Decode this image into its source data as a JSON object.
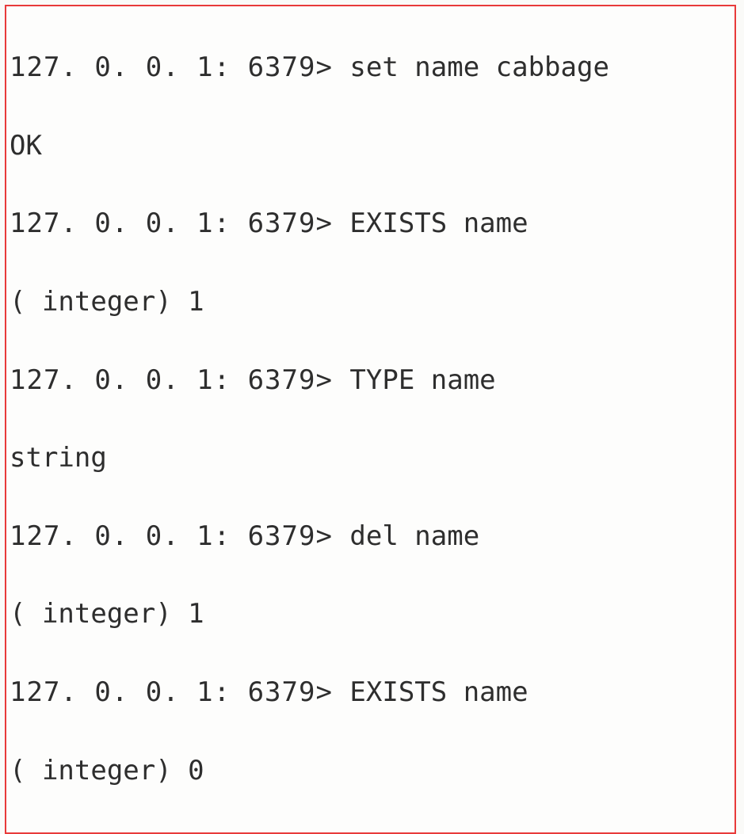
{
  "prompt": "127. 0. 0. 1: 6379> ",
  "lines": {
    "l0_cmd": "set name cabbage",
    "l0_out": "OK",
    "l1_cmd": "EXISTS name",
    "l1_out": "( integer) 1",
    "l2_cmd": "TYPE name",
    "l2_out": "string",
    "l3_cmd": "del name",
    "l3_out": "( integer) 1",
    "l4_cmd": "EXISTS name",
    "l4_out": "( integer) 0"
  }
}
